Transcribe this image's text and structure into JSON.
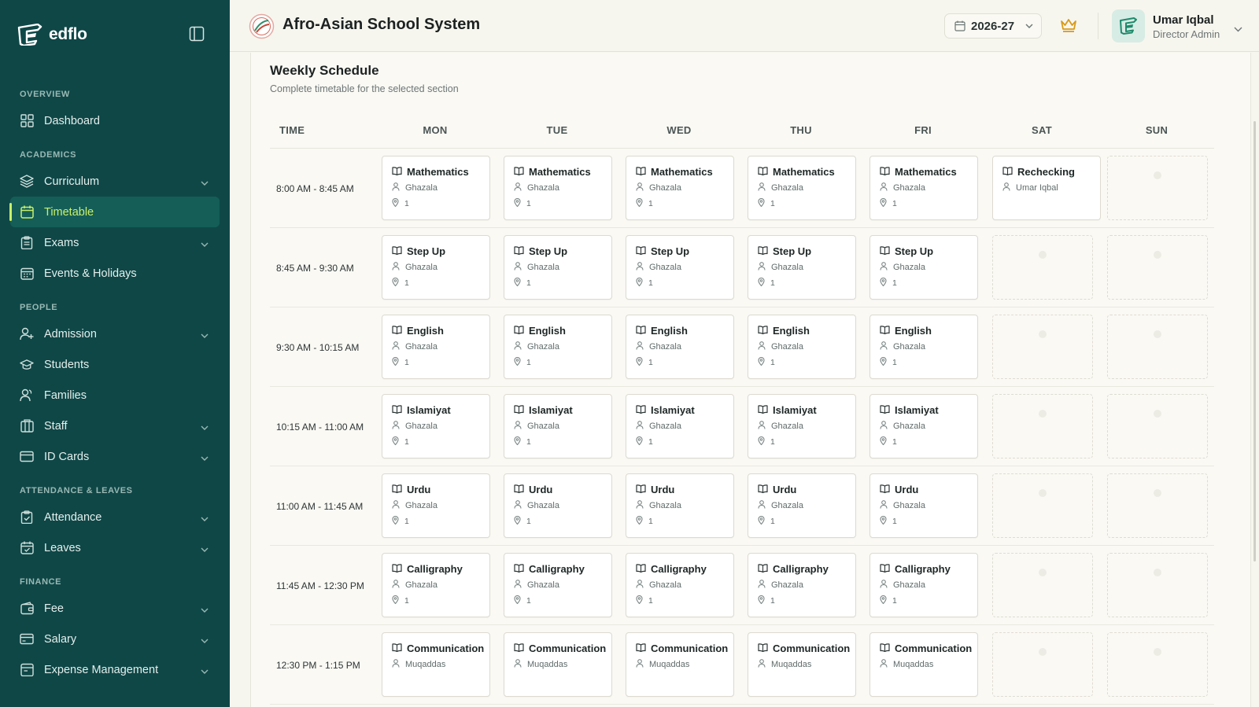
{
  "brand": {
    "name": "edflo"
  },
  "sidebar": {
    "sections": [
      {
        "title": "OVERVIEW",
        "items": [
          {
            "label": "Dashboard",
            "icon": "grid-icon",
            "expandable": false,
            "active": false
          }
        ]
      },
      {
        "title": "ACADEMICS",
        "items": [
          {
            "label": "Curriculum",
            "icon": "layers-icon",
            "expandable": true,
            "active": false
          },
          {
            "label": "Timetable",
            "icon": "calendar-icon",
            "expandable": false,
            "active": true
          },
          {
            "label": "Exams",
            "icon": "clipboard-icon",
            "expandable": true,
            "active": false
          },
          {
            "label": "Events & Holidays",
            "icon": "calendar-grid-icon",
            "expandable": false,
            "active": false
          }
        ]
      },
      {
        "title": "PEOPLE",
        "items": [
          {
            "label": "Admission",
            "icon": "user-plus-icon",
            "expandable": true,
            "active": false
          },
          {
            "label": "Students",
            "icon": "graduation-cap-icon",
            "expandable": false,
            "active": false
          },
          {
            "label": "Families",
            "icon": "users-icon",
            "expandable": false,
            "active": false
          },
          {
            "label": "Staff",
            "icon": "building-icon",
            "expandable": true,
            "active": false
          },
          {
            "label": "ID Cards",
            "icon": "id-card-icon",
            "expandable": true,
            "active": false
          }
        ]
      },
      {
        "title": "ATTENDANCE & LEAVES",
        "items": [
          {
            "label": "Attendance",
            "icon": "clipboard-check-icon",
            "expandable": true,
            "active": false
          },
          {
            "label": "Leaves",
            "icon": "calendar-check-icon",
            "expandable": true,
            "active": false
          }
        ]
      },
      {
        "title": "FINANCE",
        "items": [
          {
            "label": "Fee",
            "icon": "wallet-icon",
            "expandable": true,
            "active": false
          },
          {
            "label": "Salary",
            "icon": "card-icon",
            "expandable": true,
            "active": false
          },
          {
            "label": "Expense Management",
            "icon": "receipt-icon",
            "expandable": true,
            "active": false
          }
        ]
      }
    ]
  },
  "header": {
    "school_name": "Afro-Asian School System",
    "year": "2026-27",
    "user": {
      "name": "Umar Iqbal",
      "role": "Director Admin"
    }
  },
  "schedule": {
    "title": "Weekly Schedule",
    "subtitle": "Complete timetable for the selected section",
    "time_header": "TIME",
    "days": [
      "MON",
      "TUE",
      "WED",
      "THU",
      "FRI",
      "SAT",
      "SUN"
    ],
    "rows": [
      {
        "time": "8:00 AM - 8:45 AM",
        "cells": [
          {
            "subject": "Mathematics",
            "teacher": "Ghazala",
            "room": "1"
          },
          {
            "subject": "Mathematics",
            "teacher": "Ghazala",
            "room": "1"
          },
          {
            "subject": "Mathematics",
            "teacher": "Ghazala",
            "room": "1"
          },
          {
            "subject": "Mathematics",
            "teacher": "Ghazala",
            "room": "1"
          },
          {
            "subject": "Mathematics",
            "teacher": "Ghazala",
            "room": "1"
          },
          {
            "subject": "Rechecking",
            "teacher": "Umar Iqbal"
          },
          null
        ]
      },
      {
        "time": "8:45 AM - 9:30 AM",
        "cells": [
          {
            "subject": "Step Up",
            "teacher": "Ghazala",
            "room": "1"
          },
          {
            "subject": "Step Up",
            "teacher": "Ghazala",
            "room": "1"
          },
          {
            "subject": "Step Up",
            "teacher": "Ghazala",
            "room": "1"
          },
          {
            "subject": "Step Up",
            "teacher": "Ghazala",
            "room": "1"
          },
          {
            "subject": "Step Up",
            "teacher": "Ghazala",
            "room": "1"
          },
          null,
          null
        ]
      },
      {
        "time": "9:30 AM - 10:15 AM",
        "cells": [
          {
            "subject": "English",
            "teacher": "Ghazala",
            "room": "1"
          },
          {
            "subject": "English",
            "teacher": "Ghazala",
            "room": "1"
          },
          {
            "subject": "English",
            "teacher": "Ghazala",
            "room": "1"
          },
          {
            "subject": "English",
            "teacher": "Ghazala",
            "room": "1"
          },
          {
            "subject": "English",
            "teacher": "Ghazala",
            "room": "1"
          },
          null,
          null
        ]
      },
      {
        "time": "10:15 AM - 11:00 AM",
        "cells": [
          {
            "subject": "Islamiyat",
            "teacher": "Ghazala",
            "room": "1"
          },
          {
            "subject": "Islamiyat",
            "teacher": "Ghazala",
            "room": "1"
          },
          {
            "subject": "Islamiyat",
            "teacher": "Ghazala",
            "room": "1"
          },
          {
            "subject": "Islamiyat",
            "teacher": "Ghazala",
            "room": "1"
          },
          {
            "subject": "Islamiyat",
            "teacher": "Ghazala",
            "room": "1"
          },
          null,
          null
        ]
      },
      {
        "time": "11:00 AM - 11:45 AM",
        "cells": [
          {
            "subject": "Urdu",
            "teacher": "Ghazala",
            "room": "1"
          },
          {
            "subject": "Urdu",
            "teacher": "Ghazala",
            "room": "1"
          },
          {
            "subject": "Urdu",
            "teacher": "Ghazala",
            "room": "1"
          },
          {
            "subject": "Urdu",
            "teacher": "Ghazala",
            "room": "1"
          },
          {
            "subject": "Urdu",
            "teacher": "Ghazala",
            "room": "1"
          },
          null,
          null
        ]
      },
      {
        "time": "11:45 AM - 12:30 PM",
        "cells": [
          {
            "subject": "Calligraphy",
            "teacher": "Ghazala",
            "room": "1"
          },
          {
            "subject": "Calligraphy",
            "teacher": "Ghazala",
            "room": "1"
          },
          {
            "subject": "Calligraphy",
            "teacher": "Ghazala",
            "room": "1"
          },
          {
            "subject": "Calligraphy",
            "teacher": "Ghazala",
            "room": "1"
          },
          {
            "subject": "Calligraphy",
            "teacher": "Ghazala",
            "room": "1"
          },
          null,
          null
        ]
      },
      {
        "time": "12:30 PM - 1:15 PM",
        "cells": [
          {
            "subject": "Communication",
            "teacher": "Muqaddas"
          },
          {
            "subject": "Communication",
            "teacher": "Muqaddas"
          },
          {
            "subject": "Communication",
            "teacher": "Muqaddas"
          },
          {
            "subject": "Communication",
            "teacher": "Muqaddas"
          },
          {
            "subject": "Communication",
            "teacher": "Muqaddas"
          },
          null,
          null
        ]
      }
    ]
  },
  "colors": {
    "sidebar_bg": "#0f4747",
    "active_bg": "#155e58",
    "active_accent": "#c8f06a",
    "crown": "#d89a1a",
    "page_bg": "#f7f6ee"
  }
}
